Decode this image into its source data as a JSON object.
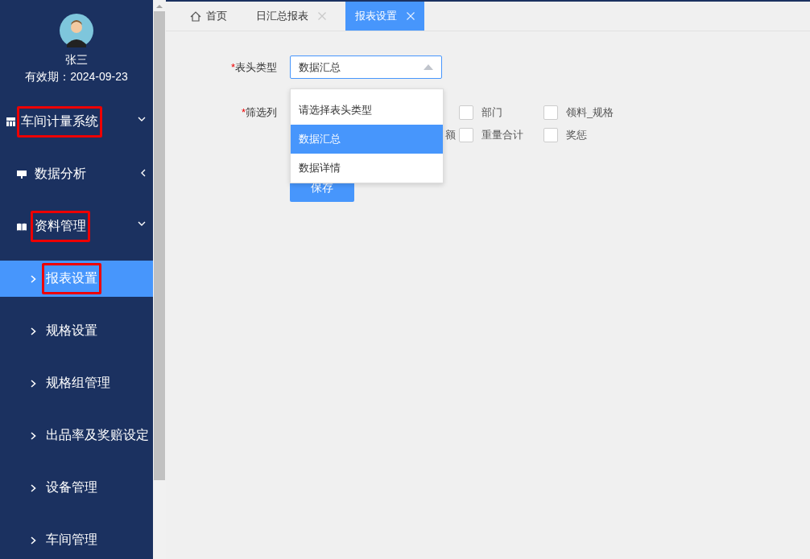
{
  "user": {
    "name": "张三",
    "validity": "有效期：2024-09-23"
  },
  "menu": [
    {
      "label": "车间计量系统",
      "kind": "system",
      "expanded": true,
      "highlighted": true,
      "children": [
        {
          "label": "数据分析",
          "kind": "analysis",
          "expanded": false,
          "highlighted": false
        },
        {
          "label": "资料管理",
          "kind": "records",
          "expanded": true,
          "highlighted": true,
          "children": [
            {
              "label": "报表设置",
              "selected": true,
              "highlighted": true
            },
            {
              "label": "规格设置",
              "selected": false,
              "highlighted": false
            },
            {
              "label": "规格组管理",
              "selected": false,
              "highlighted": false
            },
            {
              "label": "出品率及奖赔设定",
              "selected": false,
              "highlighted": false
            },
            {
              "label": "设备管理",
              "selected": false,
              "highlighted": false
            },
            {
              "label": "车间管理",
              "selected": false,
              "highlighted": false
            }
          ]
        }
      ]
    }
  ],
  "tabs": [
    {
      "label": "首页",
      "kind": "home",
      "selected": false
    },
    {
      "label": "日汇总报表",
      "kind": "closable",
      "selected": false
    },
    {
      "label": "报表设置",
      "kind": "closable",
      "selected": true
    }
  ],
  "form": {
    "header_type": {
      "required_mark": "*",
      "label": "表头类型",
      "value": "数据汇总",
      "expanded": true,
      "options": [
        {
          "label": "请选择表头类型",
          "selected": false
        },
        {
          "label": "数据汇总",
          "selected": true
        },
        {
          "label": "数据详情",
          "selected": false
        }
      ]
    },
    "filter_columns": {
      "required_mark": "*",
      "label": "筛选列",
      "rows": [
        [
          "",
          {
            "kind": "checkbox",
            "label": "部门",
            "checked": false
          },
          {
            "kind": "checkbox",
            "label": "领料_规格",
            "checked": false
          }
        ],
        [
          {
            "kind": "fragment",
            "label": "额"
          },
          {
            "kind": "checkbox",
            "label": "重量合计",
            "checked": false
          },
          {
            "kind": "checkbox",
            "label": "奖惩",
            "checked": false
          }
        ]
      ]
    },
    "save_button": "保存"
  }
}
